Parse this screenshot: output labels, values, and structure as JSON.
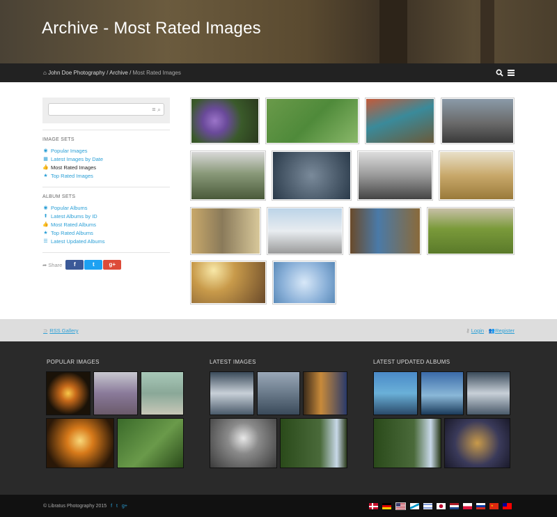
{
  "header": {
    "title": "Archive - Most Rated Images"
  },
  "breadcrumb": {
    "home": "John Doe Photography",
    "sep1": " / ",
    "archive": "Archive",
    "sep2": " / ",
    "current": "Most Rated Images"
  },
  "search": {
    "placeholder": ""
  },
  "sidebar": {
    "image_sets_title": "IMAGE SETS",
    "image_sets": [
      {
        "label": "Popular Images",
        "icon": "eye-icon"
      },
      {
        "label": "Latest Images by Date",
        "icon": "calendar-icon"
      },
      {
        "label": "Most Rated Images",
        "icon": "thumbs-up-icon"
      },
      {
        "label": "Top Rated Images",
        "icon": "star-icon"
      }
    ],
    "album_sets_title": "ALBUM SETS",
    "album_sets": [
      {
        "label": "Popular Albums",
        "icon": "eye-icon"
      },
      {
        "label": "Latest Albums by ID",
        "icon": "upload-icon"
      },
      {
        "label": "Most Rated Albums",
        "icon": "thumbs-up-icon"
      },
      {
        "label": "Top Rated Albums",
        "icon": "star-icon"
      },
      {
        "label": "Latest Updated Albums",
        "icon": "list-icon"
      }
    ],
    "share_label": "Share",
    "share_buttons": [
      "f",
      "t",
      "g+"
    ]
  },
  "links": {
    "rss": "RSS Gallery",
    "login": "Login",
    "sep": " · ",
    "register": "Register"
  },
  "footer": {
    "popular_title": "POPULAR IMAGES",
    "latest_title": "LATEST IMAGES",
    "albums_title": "LATEST UPDATED ALBUMS"
  },
  "bottom": {
    "copyright": "© Libratus Photography 2015",
    "social": [
      "f",
      "t",
      "g+"
    ]
  },
  "colors": {
    "accent": "#2a9fd6",
    "navbar": "#222222",
    "footer": "#2a2a2a",
    "facebook": "#3b5998",
    "twitter": "#1da1f2",
    "google": "#dd4b39"
  },
  "languages": [
    "Danish",
    "German",
    "English",
    "Galician",
    "Hebrew",
    "Japanese",
    "Dutch",
    "Polish",
    "Russian",
    "Chinese",
    "Taiwanese"
  ]
}
